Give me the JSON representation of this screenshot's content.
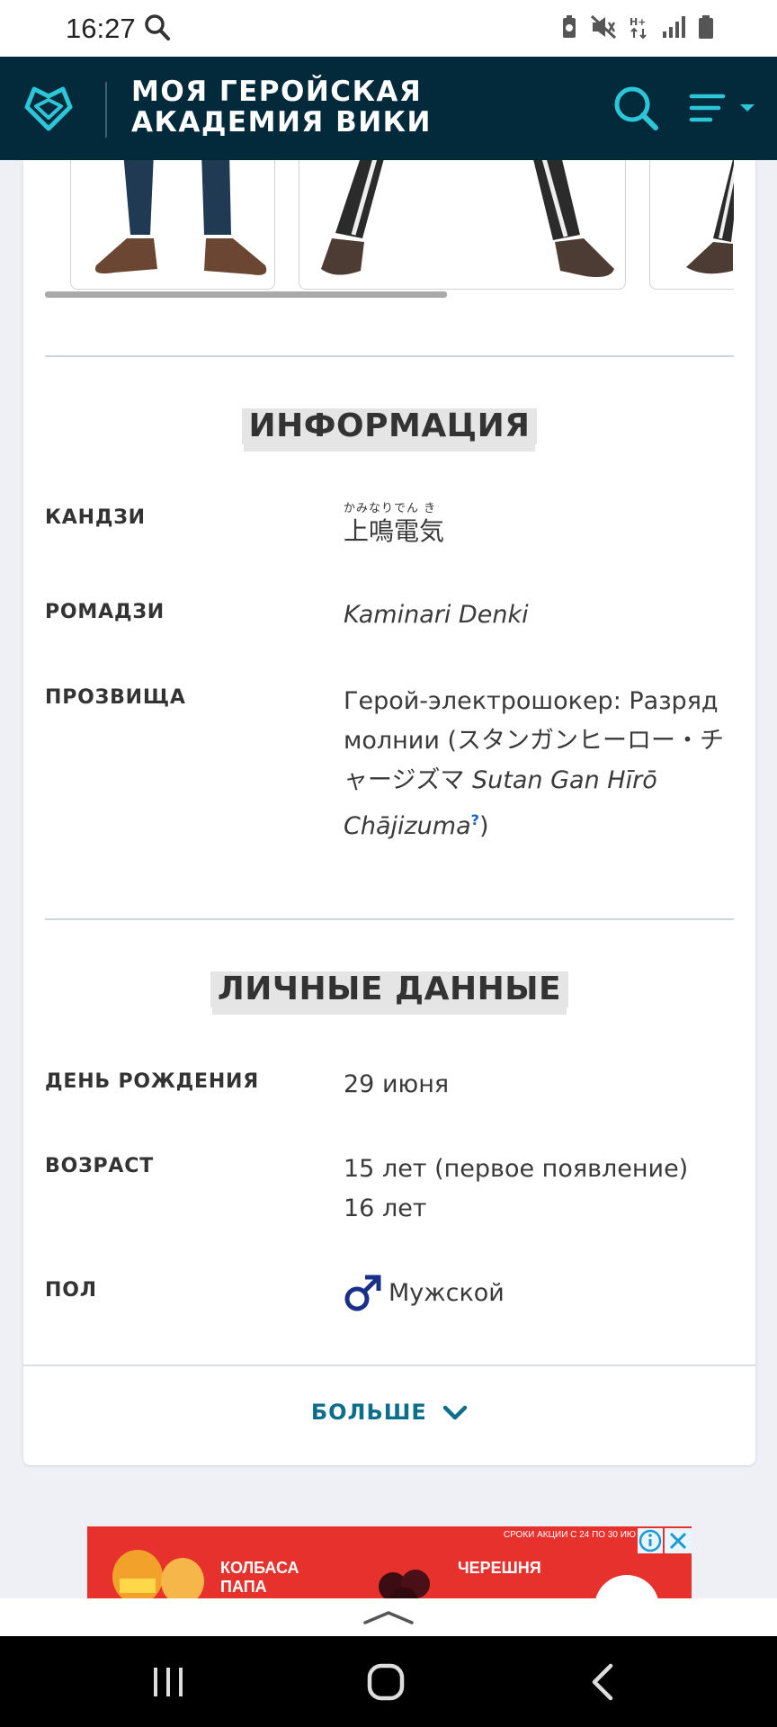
{
  "status_bar": {
    "time": "16:27"
  },
  "header": {
    "title": "МОЯ ГЕРОЙСКАЯ АКАДЕМИЯ ВИКИ",
    "logo_icon": "heart-diamond-logo-icon",
    "search_icon": "search-icon",
    "menu_icon": "menu-icon"
  },
  "info_section": {
    "title": "ИНФОРМАЦИЯ",
    "rows": [
      {
        "label": "КАНДЗИ",
        "furigana": "かみなりでん き",
        "value": "上鳴電気"
      },
      {
        "label": "РОМАДЗИ",
        "value": "Kaminari Denki"
      },
      {
        "label": "ПРОЗВИЩА",
        "value_prefix": "Герой-электрошокер: Разряд молнии (スタンガンヒーロー・チャージズマ ",
        "value_italic": "Sutan Gan Hīrō Chājizuma",
        "help_mark": "?",
        "value_suffix": ")"
      }
    ]
  },
  "personal_section": {
    "title": "ЛИЧНЫЕ ДАННЫЕ",
    "rows": [
      {
        "label": "ДЕНЬ РОЖДЕНИЯ",
        "value": "29 июня"
      },
      {
        "label": "ВОЗРАСТ",
        "value_line1": "15 лет (первое появление)",
        "value_line2": "16 лет"
      },
      {
        "label": "ПОЛ",
        "value": "Мужской",
        "icon": "male-symbol-icon"
      }
    ]
  },
  "more_button": {
    "label": "БОЛЬШЕ"
  },
  "ad": {
    "top_text": "СРОКИ АКЦИИ С 24 ПО 30 ИЮ",
    "item1": "КОЛБАСА ПАПА",
    "item2": "ЧЕРЕШНЯ"
  },
  "colors": {
    "header_bg": "#032a3a",
    "accent_cyan": "#2bc7d8",
    "link_teal": "#0d6e8c",
    "ad_red": "#e6312c"
  }
}
